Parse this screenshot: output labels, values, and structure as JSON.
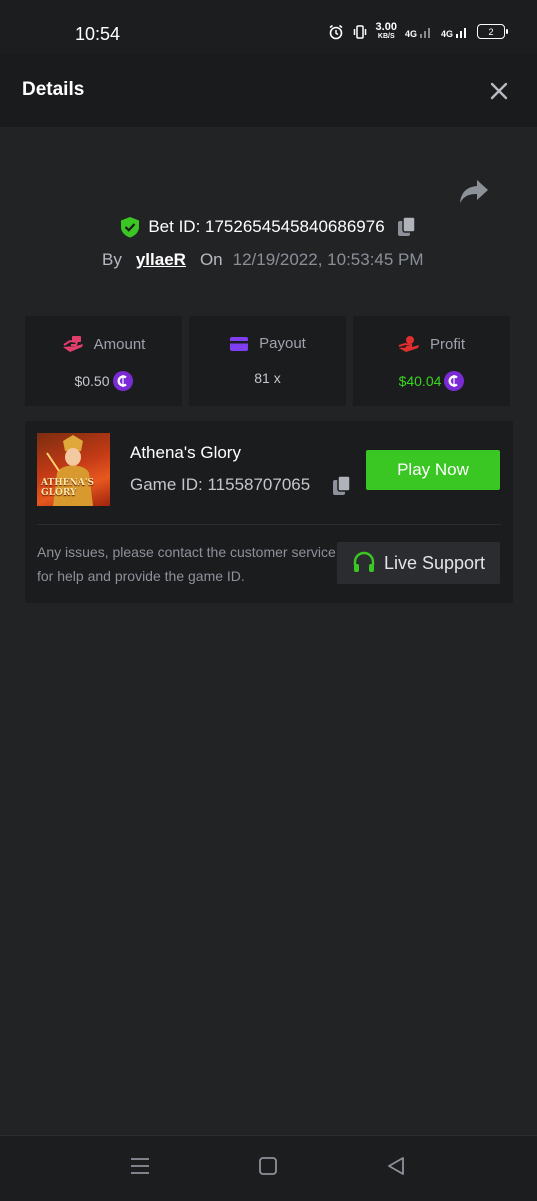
{
  "status_bar": {
    "time": "10:54",
    "net_speed_value": "3.00",
    "net_speed_unit": "KB/S",
    "network_1": "4G",
    "network_2": "4G",
    "battery": "2"
  },
  "header": {
    "title": "Details"
  },
  "bet": {
    "bet_id": "Bet ID: 1752654545840686976",
    "by_label": "By",
    "username": "yllaeR",
    "on_label": "On",
    "datetime": "12/19/2022, 10:53:45 PM"
  },
  "stats": [
    {
      "label": "Amount",
      "value": "$0.50",
      "icon": "money-hand-icon",
      "color": "#e23e6c"
    },
    {
      "label": "Payout",
      "value": "81 x",
      "icon": "wallet-card-icon",
      "color": "#7f3ef0"
    },
    {
      "label": "Profit",
      "value": "$40.04",
      "icon": "profit-hand-icon",
      "color": "#e02f2f"
    }
  ],
  "game": {
    "thumbnail_text": "ATHENA'S GLORY",
    "name": "Athena's Glory",
    "game_id": "Game ID: 11558707065",
    "play_label": "Play Now",
    "support_text": "Any issues, please contact the customer service for help and provide the game ID.",
    "support_label": "Live Support"
  },
  "colors": {
    "accent_green": "#3ac623",
    "profit_green": "#37d51c",
    "coin_purple": "#7b2bd6",
    "background": "#222325"
  }
}
